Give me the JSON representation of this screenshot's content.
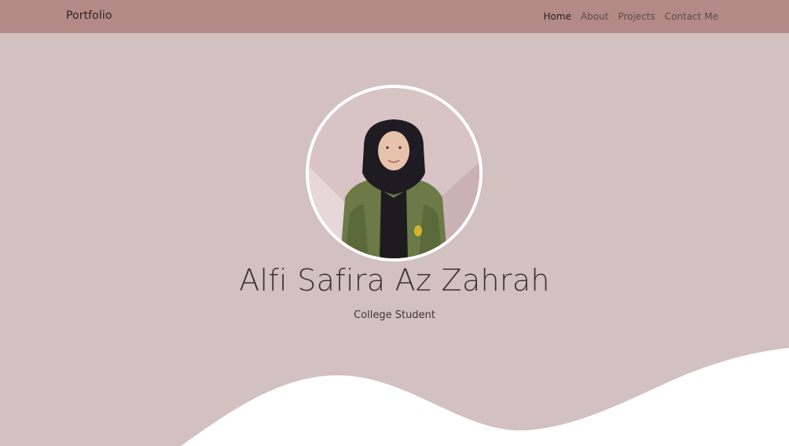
{
  "navbar": {
    "brand": "Portfolio",
    "links": [
      {
        "label": "Home"
      },
      {
        "label": "About"
      },
      {
        "label": "Projects"
      },
      {
        "label": "Contact Me"
      }
    ]
  },
  "hero": {
    "name": "Alfi Safira Az Zahrah",
    "subtitle": "College Student"
  }
}
